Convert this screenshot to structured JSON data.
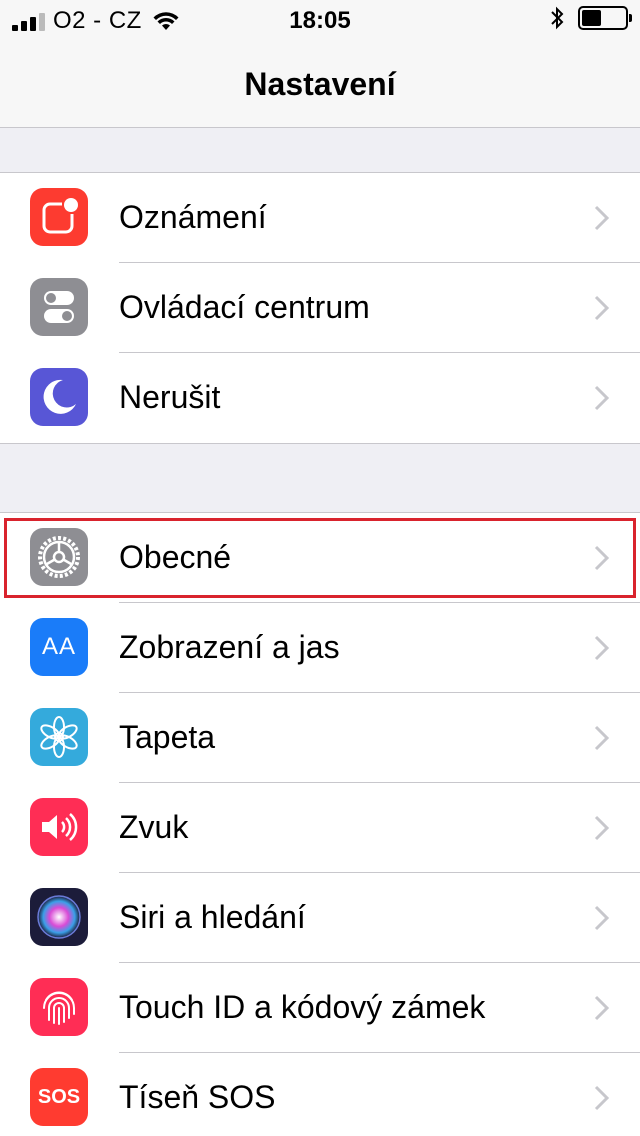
{
  "status_bar": {
    "carrier": "O2 - CZ",
    "time": "18:05",
    "battery_percent": 45
  },
  "nav": {
    "title": "Nastavení"
  },
  "groups": [
    {
      "items": [
        {
          "label": "Oznámení",
          "icon": "notifications-icon",
          "color": "#fd3b30"
        },
        {
          "label": "Ovládací centrum",
          "icon": "control-center-icon",
          "color": "#8e8e93"
        },
        {
          "label": "Nerušit",
          "icon": "moon-icon",
          "color": "#5856d6"
        }
      ]
    },
    {
      "items": [
        {
          "label": "Obecné",
          "icon": "gear-icon",
          "color": "#8e8e93"
        },
        {
          "label": "Zobrazení a jas",
          "icon": "text-size-icon",
          "color": "#1a7cf9",
          "icon_text": "AA"
        },
        {
          "label": "Tapeta",
          "icon": "flower-icon",
          "color": "#34aadc"
        },
        {
          "label": "Zvuk",
          "icon": "speaker-icon",
          "color": "#ff2d55"
        },
        {
          "label": "Siri a hledání",
          "icon": "siri-icon",
          "color": "#1c1c3a"
        },
        {
          "label": "Touch ID a kódový zámek",
          "icon": "fingerprint-icon",
          "color": "#ff2d55"
        },
        {
          "label": "Tíseň SOS",
          "icon": "sos-icon",
          "color": "#ff3b30",
          "icon_text": "SOS"
        }
      ]
    }
  ],
  "highlight_color": "#d9232d"
}
